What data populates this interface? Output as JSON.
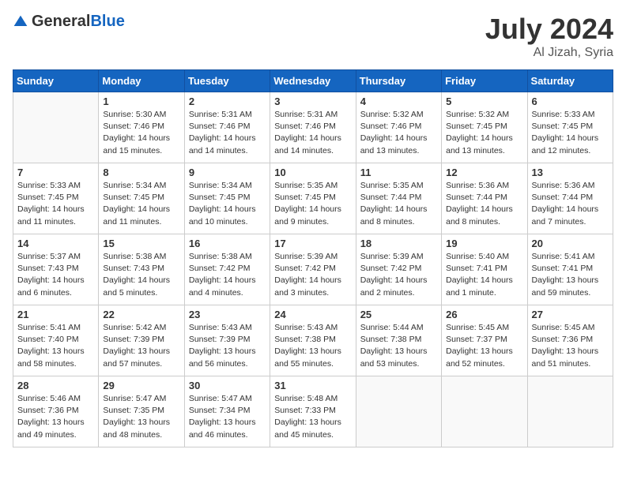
{
  "header": {
    "logo_general": "General",
    "logo_blue": "Blue",
    "title": "July 2024",
    "location": "Al Jizah, Syria"
  },
  "days_of_week": [
    "Sunday",
    "Monday",
    "Tuesday",
    "Wednesday",
    "Thursday",
    "Friday",
    "Saturday"
  ],
  "weeks": [
    [
      {
        "day": "",
        "sunrise": "",
        "sunset": "",
        "daylight": "",
        "empty": true
      },
      {
        "day": "1",
        "sunrise": "Sunrise: 5:30 AM",
        "sunset": "Sunset: 7:46 PM",
        "daylight": "Daylight: 14 hours and 15 minutes."
      },
      {
        "day": "2",
        "sunrise": "Sunrise: 5:31 AM",
        "sunset": "Sunset: 7:46 PM",
        "daylight": "Daylight: 14 hours and 14 minutes."
      },
      {
        "day": "3",
        "sunrise": "Sunrise: 5:31 AM",
        "sunset": "Sunset: 7:46 PM",
        "daylight": "Daylight: 14 hours and 14 minutes."
      },
      {
        "day": "4",
        "sunrise": "Sunrise: 5:32 AM",
        "sunset": "Sunset: 7:46 PM",
        "daylight": "Daylight: 14 hours and 13 minutes."
      },
      {
        "day": "5",
        "sunrise": "Sunrise: 5:32 AM",
        "sunset": "Sunset: 7:45 PM",
        "daylight": "Daylight: 14 hours and 13 minutes."
      },
      {
        "day": "6",
        "sunrise": "Sunrise: 5:33 AM",
        "sunset": "Sunset: 7:45 PM",
        "daylight": "Daylight: 14 hours and 12 minutes."
      }
    ],
    [
      {
        "day": "7",
        "sunrise": "Sunrise: 5:33 AM",
        "sunset": "Sunset: 7:45 PM",
        "daylight": "Daylight: 14 hours and 11 minutes."
      },
      {
        "day": "8",
        "sunrise": "Sunrise: 5:34 AM",
        "sunset": "Sunset: 7:45 PM",
        "daylight": "Daylight: 14 hours and 11 minutes."
      },
      {
        "day": "9",
        "sunrise": "Sunrise: 5:34 AM",
        "sunset": "Sunset: 7:45 PM",
        "daylight": "Daylight: 14 hours and 10 minutes."
      },
      {
        "day": "10",
        "sunrise": "Sunrise: 5:35 AM",
        "sunset": "Sunset: 7:45 PM",
        "daylight": "Daylight: 14 hours and 9 minutes."
      },
      {
        "day": "11",
        "sunrise": "Sunrise: 5:35 AM",
        "sunset": "Sunset: 7:44 PM",
        "daylight": "Daylight: 14 hours and 8 minutes."
      },
      {
        "day": "12",
        "sunrise": "Sunrise: 5:36 AM",
        "sunset": "Sunset: 7:44 PM",
        "daylight": "Daylight: 14 hours and 8 minutes."
      },
      {
        "day": "13",
        "sunrise": "Sunrise: 5:36 AM",
        "sunset": "Sunset: 7:44 PM",
        "daylight": "Daylight: 14 hours and 7 minutes."
      }
    ],
    [
      {
        "day": "14",
        "sunrise": "Sunrise: 5:37 AM",
        "sunset": "Sunset: 7:43 PM",
        "daylight": "Daylight: 14 hours and 6 minutes."
      },
      {
        "day": "15",
        "sunrise": "Sunrise: 5:38 AM",
        "sunset": "Sunset: 7:43 PM",
        "daylight": "Daylight: 14 hours and 5 minutes."
      },
      {
        "day": "16",
        "sunrise": "Sunrise: 5:38 AM",
        "sunset": "Sunset: 7:42 PM",
        "daylight": "Daylight: 14 hours and 4 minutes."
      },
      {
        "day": "17",
        "sunrise": "Sunrise: 5:39 AM",
        "sunset": "Sunset: 7:42 PM",
        "daylight": "Daylight: 14 hours and 3 minutes."
      },
      {
        "day": "18",
        "sunrise": "Sunrise: 5:39 AM",
        "sunset": "Sunset: 7:42 PM",
        "daylight": "Daylight: 14 hours and 2 minutes."
      },
      {
        "day": "19",
        "sunrise": "Sunrise: 5:40 AM",
        "sunset": "Sunset: 7:41 PM",
        "daylight": "Daylight: 14 hours and 1 minute."
      },
      {
        "day": "20",
        "sunrise": "Sunrise: 5:41 AM",
        "sunset": "Sunset: 7:41 PM",
        "daylight": "Daylight: 13 hours and 59 minutes."
      }
    ],
    [
      {
        "day": "21",
        "sunrise": "Sunrise: 5:41 AM",
        "sunset": "Sunset: 7:40 PM",
        "daylight": "Daylight: 13 hours and 58 minutes."
      },
      {
        "day": "22",
        "sunrise": "Sunrise: 5:42 AM",
        "sunset": "Sunset: 7:39 PM",
        "daylight": "Daylight: 13 hours and 57 minutes."
      },
      {
        "day": "23",
        "sunrise": "Sunrise: 5:43 AM",
        "sunset": "Sunset: 7:39 PM",
        "daylight": "Daylight: 13 hours and 56 minutes."
      },
      {
        "day": "24",
        "sunrise": "Sunrise: 5:43 AM",
        "sunset": "Sunset: 7:38 PM",
        "daylight": "Daylight: 13 hours and 55 minutes."
      },
      {
        "day": "25",
        "sunrise": "Sunrise: 5:44 AM",
        "sunset": "Sunset: 7:38 PM",
        "daylight": "Daylight: 13 hours and 53 minutes."
      },
      {
        "day": "26",
        "sunrise": "Sunrise: 5:45 AM",
        "sunset": "Sunset: 7:37 PM",
        "daylight": "Daylight: 13 hours and 52 minutes."
      },
      {
        "day": "27",
        "sunrise": "Sunrise: 5:45 AM",
        "sunset": "Sunset: 7:36 PM",
        "daylight": "Daylight: 13 hours and 51 minutes."
      }
    ],
    [
      {
        "day": "28",
        "sunrise": "Sunrise: 5:46 AM",
        "sunset": "Sunset: 7:36 PM",
        "daylight": "Daylight: 13 hours and 49 minutes."
      },
      {
        "day": "29",
        "sunrise": "Sunrise: 5:47 AM",
        "sunset": "Sunset: 7:35 PM",
        "daylight": "Daylight: 13 hours and 48 minutes."
      },
      {
        "day": "30",
        "sunrise": "Sunrise: 5:47 AM",
        "sunset": "Sunset: 7:34 PM",
        "daylight": "Daylight: 13 hours and 46 minutes."
      },
      {
        "day": "31",
        "sunrise": "Sunrise: 5:48 AM",
        "sunset": "Sunset: 7:33 PM",
        "daylight": "Daylight: 13 hours and 45 minutes."
      },
      {
        "day": "",
        "sunrise": "",
        "sunset": "",
        "daylight": "",
        "empty": true
      },
      {
        "day": "",
        "sunrise": "",
        "sunset": "",
        "daylight": "",
        "empty": true
      },
      {
        "day": "",
        "sunrise": "",
        "sunset": "",
        "daylight": "",
        "empty": true
      }
    ]
  ]
}
